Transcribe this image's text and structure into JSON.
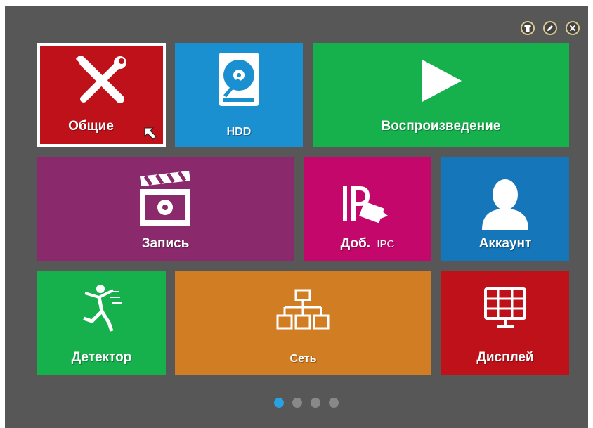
{
  "colors": {
    "background": "#575757",
    "red": "#be1119",
    "blue": "#1a90d0",
    "green": "#16b14d",
    "purple": "#8a2a6c",
    "magenta": "#c4076a",
    "dark_blue": "#1576b9",
    "orange": "#d07d23",
    "dot_active": "#2aa1e0"
  },
  "window_controls": [
    {
      "name": "shirt-icon"
    },
    {
      "name": "edit-icon"
    },
    {
      "name": "close-icon"
    }
  ],
  "tiles": {
    "general": {
      "label": "Общие",
      "icon": "tools-icon"
    },
    "hdd": {
      "label": "HDD",
      "icon": "hdd-icon"
    },
    "playback": {
      "label": "Воспроизведение",
      "icon": "play-icon"
    },
    "record": {
      "label": "Запись",
      "icon": "clapperboard-icon"
    },
    "add_ipc": {
      "label_main": "Доб.",
      "label_suffix": "IPC",
      "icon": "ip-camera-icon"
    },
    "account": {
      "label": "Аккаунт",
      "icon": "user-icon"
    },
    "detector": {
      "label": "Детектор",
      "icon": "running-man-icon"
    },
    "network": {
      "label": "Сеть",
      "icon": "network-icon"
    },
    "display": {
      "label": "Дисплей",
      "icon": "monitor-grid-icon"
    }
  },
  "pagination": {
    "pages": 4,
    "active": 1
  }
}
